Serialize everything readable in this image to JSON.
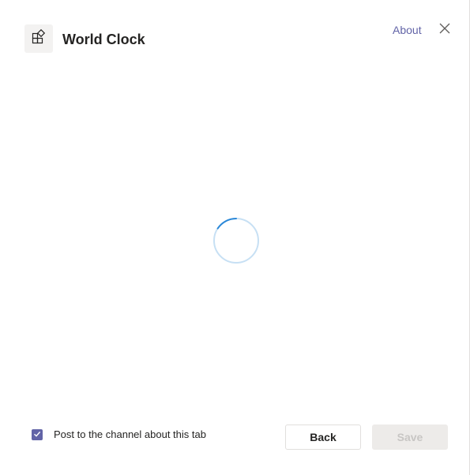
{
  "dialog": {
    "app_name": "World Clock",
    "app_icon": "apps-add-icon",
    "about_label": "About",
    "close_icon": "close-icon"
  },
  "main": {
    "loading_indicator": "spinner"
  },
  "footer": {
    "post_to_channel": {
      "label": "Post to the channel about this tab",
      "checked": true
    },
    "back_label": "Back",
    "save_label": "Save",
    "save_enabled": false
  },
  "colors": {
    "accent": "#6264a7",
    "spinner": "#2b88d8",
    "spinner_track": "#c7e0f4",
    "disabled_bg": "#edebe9",
    "disabled_text": "#c8c6c4"
  }
}
